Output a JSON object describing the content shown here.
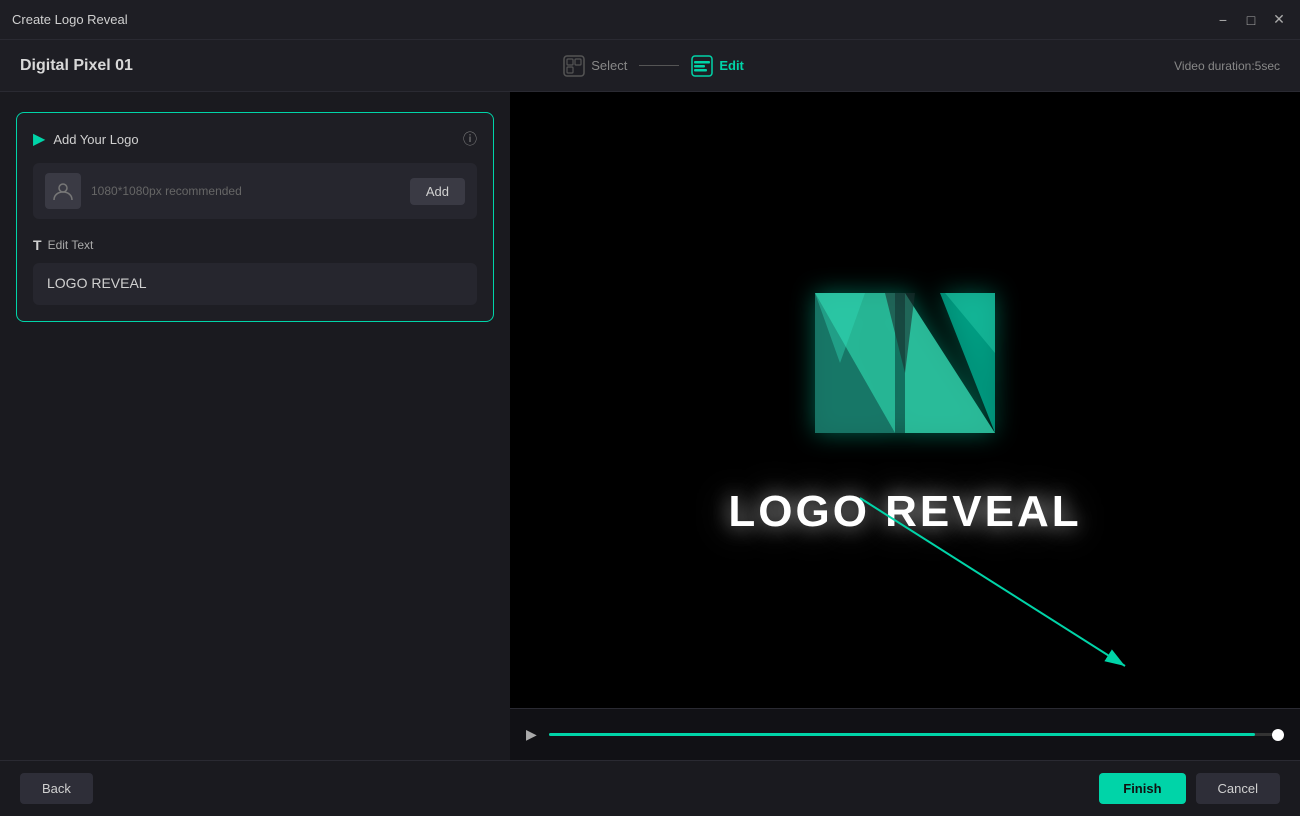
{
  "titleBar": {
    "title": "Create Logo Reveal",
    "minimizeIcon": "minimize-icon",
    "maximizeIcon": "maximize-icon",
    "closeIcon": "close-icon"
  },
  "topBar": {
    "projectName": "Digital Pixel 01",
    "steps": [
      {
        "label": "Select",
        "active": false
      },
      {
        "label": "Edit",
        "active": true
      }
    ],
    "videoDuration": "Video duration:5sec"
  },
  "leftPanel": {
    "addLogoSection": {
      "title": "Add Your Logo",
      "placeholder": "1080*1080px recommended",
      "addButtonLabel": "Add"
    },
    "editTextSection": {
      "label": "Edit Text",
      "textValue": "LOGO REVEAL"
    }
  },
  "preview": {
    "logoText": "LOGO REVEAL"
  },
  "bottomBar": {
    "backLabel": "Back",
    "finishLabel": "Finish",
    "cancelLabel": "Cancel"
  },
  "timeline": {
    "playIcon": "▶"
  }
}
